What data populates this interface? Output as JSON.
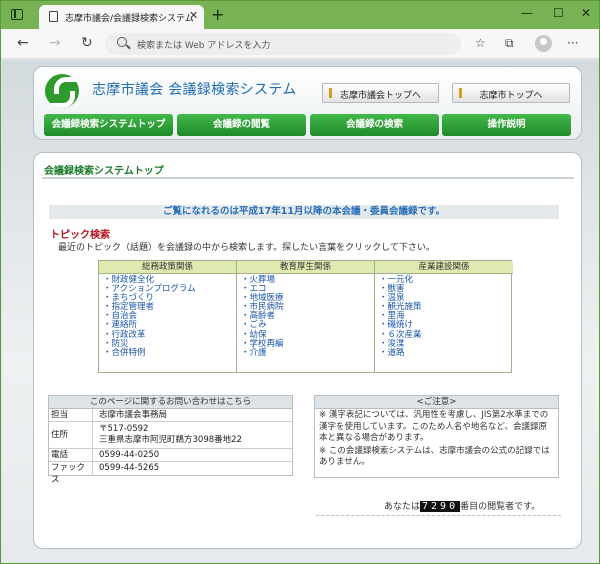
{
  "browser": {
    "tab_title": "志摩市議会/会議録検索システム",
    "tab_close": "✕",
    "new_tab": "+",
    "window_controls": {
      "minimize": "—",
      "maximize": "☐",
      "close": "✕"
    },
    "nav": {
      "back": "←",
      "forward": "→",
      "reload": "↻"
    },
    "address_placeholder": "検索または Web アドレスを入力",
    "toolbar_icons": {
      "favorite": "☆",
      "collections": "⧉",
      "more": "···"
    }
  },
  "header": {
    "site_title": "志摩市議会 会議録検索システム",
    "top_buttons": [
      "志摩市議会トップへ",
      "志摩市トップへ"
    ],
    "menu": [
      "会議録検索システムトップ",
      "会議録の閲覧",
      "会議録の検索",
      "操作説明"
    ]
  },
  "content": {
    "section_title": "会議録検索システムトップ",
    "notice": "ご覧になれるのは平成17年11月以降の本会議・委員会議録です。",
    "topic_heading": "トピック検索",
    "topic_desc": "最近のトピック（話題）を会議録の中から検索します。探したい言葉をクリックして下さい。",
    "categories": [
      {
        "title": "総務政策関係",
        "items": [
          "財政健全化",
          "アクションプログラム",
          "まちづくり",
          "指定管理者",
          "自治会",
          "連絡所",
          "行政改革",
          "防災",
          "合併特例"
        ]
      },
      {
        "title": "教育厚生関係",
        "items": [
          "火葬場",
          "エコ",
          "地域医療",
          "市民病院",
          "高齢者",
          "ごみ",
          "幼保",
          "学校再編",
          "介護"
        ]
      },
      {
        "title": "産業建設関係",
        "items": [
          "一元化",
          "獣害",
          "温泉",
          "観光施策",
          "里海",
          "磯焼け",
          "６次産業",
          "浚渫",
          "道路"
        ]
      }
    ],
    "contact": {
      "title": "このページに関するお問い合わせはこちら",
      "rows": [
        {
          "key": "担当",
          "value": "志摩市議会事務局"
        },
        {
          "key": "住所",
          "value": "〒517-0592",
          "value2": "三重県志摩市阿児町鵜方3098番地22"
        },
        {
          "key": "電話",
          "value": "0599-44-0250"
        },
        {
          "key": "ファックス",
          "value": "0599-44-5265"
        }
      ]
    },
    "caution": {
      "title": "<ご注意>",
      "p1": "※ 漢字表記については、汎用性を考慮し、JIS第2水準までの漢字を使用しています。このため人名や地名など、会議録原本と異なる場合があります。",
      "p2": "※ この会議録検索システムは、志摩市議会の公式の記録ではありません。"
    },
    "counter": {
      "prefix": "あなたは",
      "count": "7290",
      "suffix": "番目の閲覧者です。"
    }
  }
}
